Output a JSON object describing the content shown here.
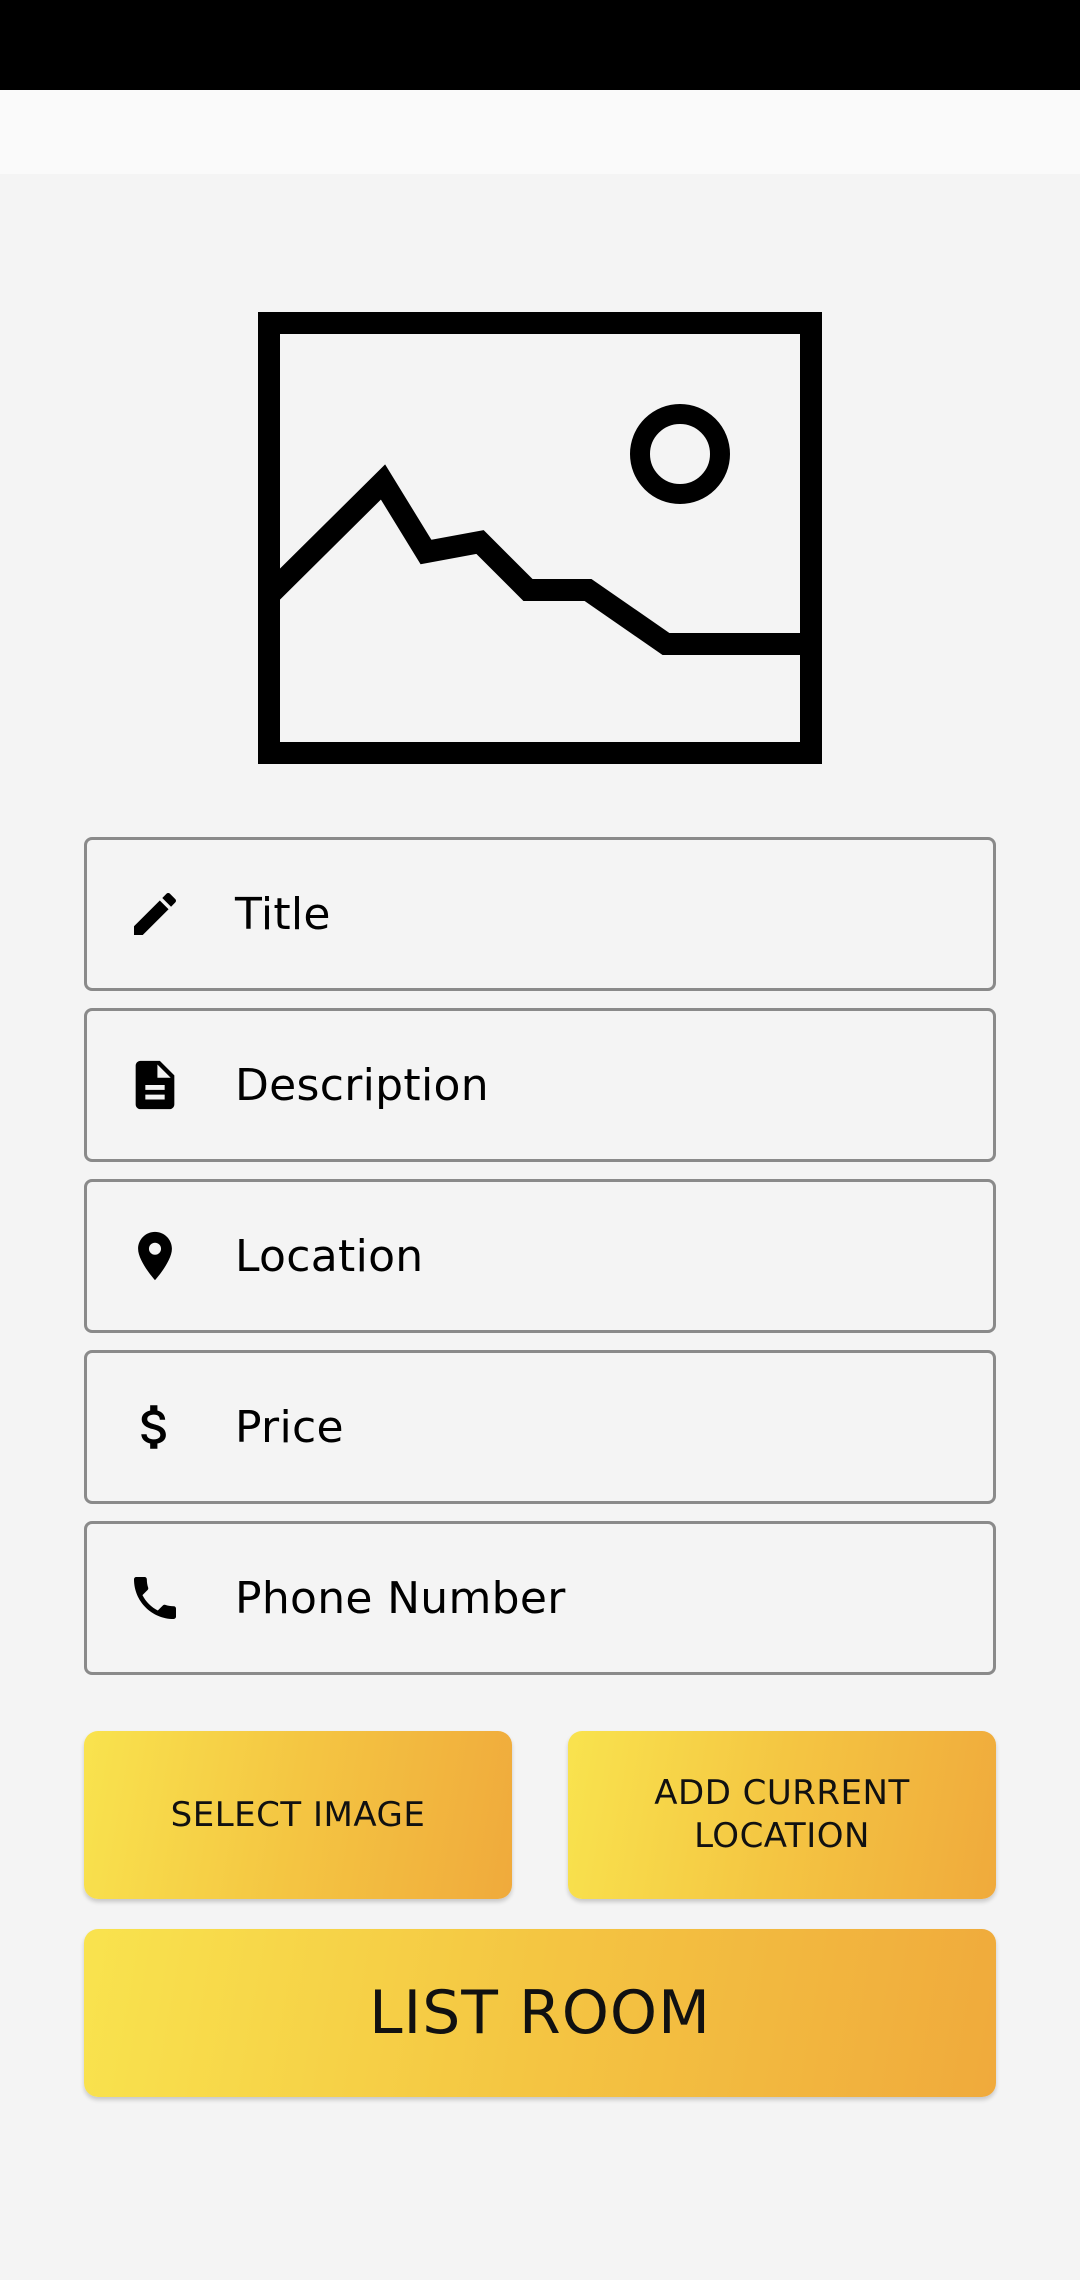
{
  "image_placeholder": {
    "icon": "image-icon"
  },
  "form": {
    "fields": [
      {
        "icon": "pencil-icon",
        "placeholder": "Title"
      },
      {
        "icon": "document-icon",
        "placeholder": "Description"
      },
      {
        "icon": "location-pin-icon",
        "placeholder": "Location"
      },
      {
        "icon": "dollar-icon",
        "placeholder": "Price"
      },
      {
        "icon": "phone-icon",
        "placeholder": "Phone Number"
      }
    ]
  },
  "buttons": {
    "select_image": "SELECT IMAGE",
    "add_current_location": "ADD CURRENT LOCATION",
    "list_room": "LIST ROOM"
  },
  "colors": {
    "status_bar": "#000000",
    "app_bar": "#fafafa",
    "background": "#f4f4f4",
    "button_gradient_start": "#f9e34e",
    "button_gradient_end": "#f0aa3c",
    "field_border": "#8a8a8a"
  }
}
